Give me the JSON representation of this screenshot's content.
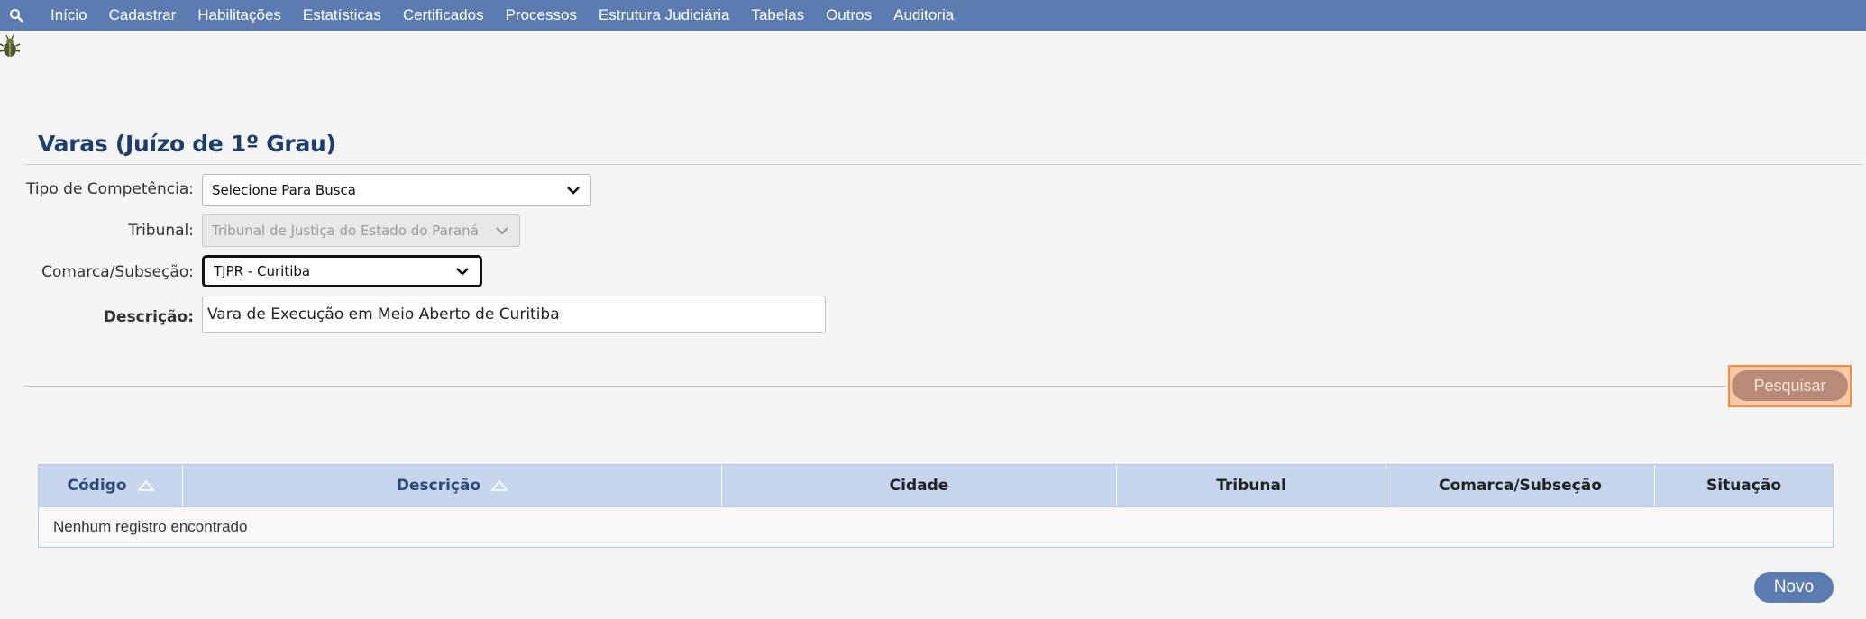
{
  "nav": {
    "search_icon": "search-icon",
    "items": [
      {
        "label": "Início"
      },
      {
        "label": "Cadastrar"
      },
      {
        "label": "Habilitações"
      },
      {
        "label": "Estatísticas"
      },
      {
        "label": "Certificados"
      },
      {
        "label": "Processos"
      },
      {
        "label": "Estrutura Judiciária"
      },
      {
        "label": "Tabelas"
      },
      {
        "label": "Outros"
      },
      {
        "label": "Auditoria"
      }
    ]
  },
  "page": {
    "title": "Varas (Juízo de 1º Grau)"
  },
  "form": {
    "tipo_competencia": {
      "label": "Tipo de Competência:",
      "value": "Selecione Para Busca"
    },
    "tribunal": {
      "label": "Tribunal:",
      "value": "Tribunal de Justiça do Estado do Paraná",
      "disabled": true
    },
    "comarca": {
      "label": "Comarca/Subseção:",
      "value": "TJPR - Curitiba"
    },
    "descricao": {
      "label": "Descrição:",
      "value": "Vara de Execução em Meio Aberto de Curitiba"
    }
  },
  "buttons": {
    "search": "Pesquisar",
    "new": "Novo"
  },
  "table": {
    "columns": [
      {
        "label": "Código",
        "sortable": true
      },
      {
        "label": "Descrição",
        "sortable": true
      },
      {
        "label": "Cidade",
        "sortable": false
      },
      {
        "label": "Tribunal",
        "sortable": false
      },
      {
        "label": "Comarca/Subseção",
        "sortable": false
      },
      {
        "label": "Situação",
        "sortable": false
      }
    ],
    "empty_message": "Nenhum registro encontrado"
  },
  "colors": {
    "nav_bg": "#5b7bb1",
    "title": "#1f3d6b",
    "header_bg": "#c8d6ed",
    "search_btn": "#b98a78",
    "focus_outline": "#ff8c3a"
  }
}
